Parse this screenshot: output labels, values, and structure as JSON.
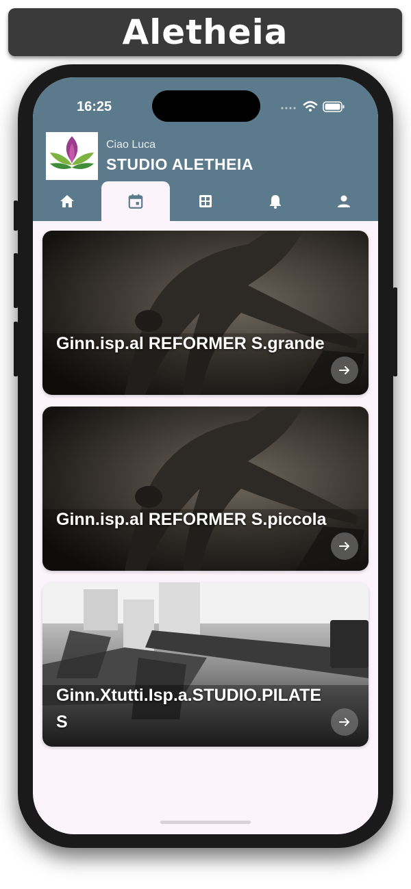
{
  "banner": {
    "title": "Aletheia"
  },
  "status_bar": {
    "time": "16:25"
  },
  "header": {
    "greeting": "Ciao Luca",
    "studio_name": "STUDIO ALETHEIA",
    "logo_icon": "lotus-logo-icon"
  },
  "tabs": [
    {
      "icon": "home-icon",
      "active": false
    },
    {
      "icon": "calendar-icon",
      "active": true
    },
    {
      "icon": "grid-icon",
      "active": false
    },
    {
      "icon": "bell-icon",
      "active": false
    },
    {
      "icon": "person-icon",
      "active": false
    }
  ],
  "courses": [
    {
      "title": "Ginn.isp.al REFORMER S.grande",
      "image": "pilates-pose-photo",
      "arrow_icon": "arrow-right-icon"
    },
    {
      "title": "Ginn.isp.al REFORMER S.piccola",
      "image": "pilates-pose-photo",
      "arrow_icon": "arrow-right-icon"
    },
    {
      "title": "Ginn.Xtutti.Isp.a.STUDIO.PILATES",
      "image": "pilates-studio-reformers-photo",
      "arrow_icon": "arrow-right-icon"
    }
  ],
  "colors": {
    "header": "#5b7a8c",
    "background": "#fcf4fb",
    "banner": "#3a3a3a"
  }
}
